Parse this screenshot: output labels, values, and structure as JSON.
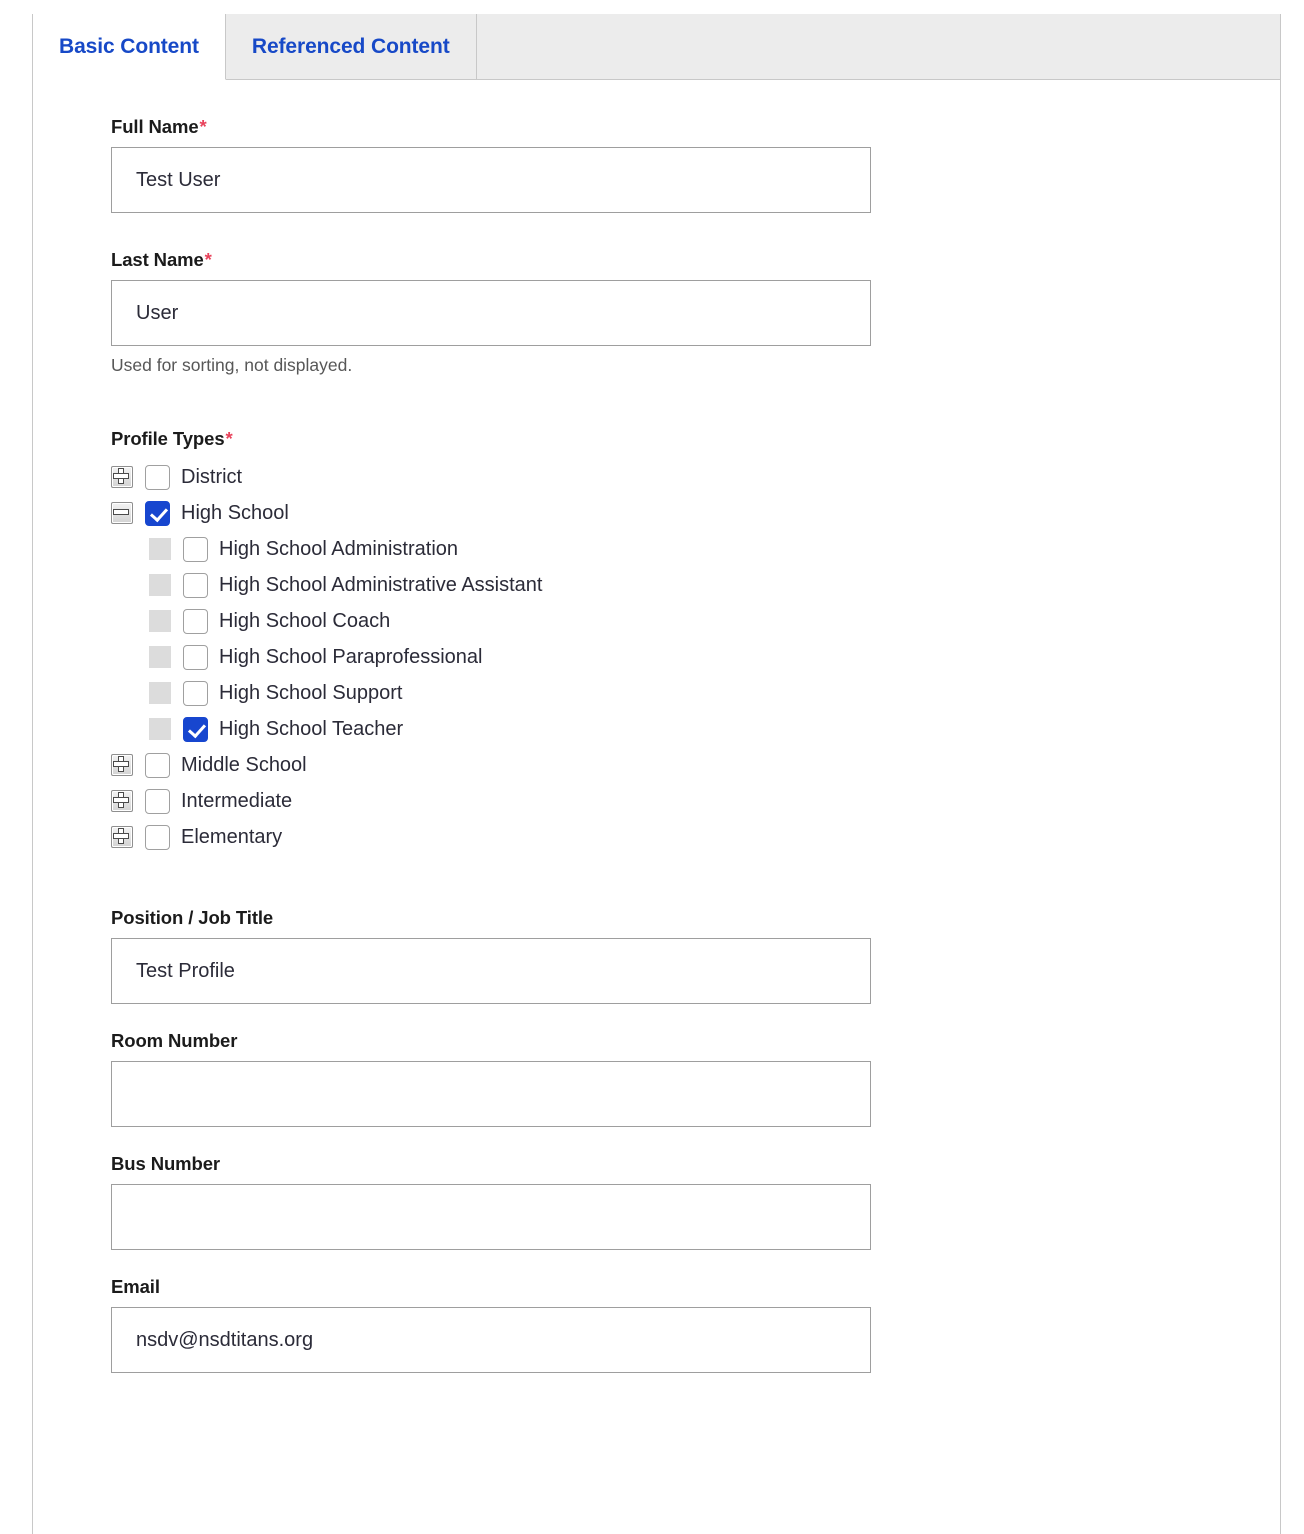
{
  "tabs": [
    {
      "label": "Basic Content",
      "active": true
    },
    {
      "label": "Referenced Content",
      "active": false
    }
  ],
  "fields": {
    "full_name": {
      "label": "Full Name",
      "required": true,
      "value": "Test User",
      "placeholder": ""
    },
    "last_name": {
      "label": "Last Name",
      "required": true,
      "value": "User",
      "placeholder": "",
      "helper": "Used for sorting, not displayed."
    },
    "profile_types": {
      "label": "Profile Types",
      "required": true
    },
    "position": {
      "label": "Position / Job Title",
      "required": false,
      "value": "Test Profile",
      "placeholder": ""
    },
    "room_number": {
      "label": "Room Number",
      "required": false,
      "value": "",
      "placeholder": ""
    },
    "bus_number": {
      "label": "Bus Number",
      "required": false,
      "value": "",
      "placeholder": ""
    },
    "email": {
      "label": "Email",
      "required": false,
      "value": "nsdv@nsdtitans.org",
      "placeholder": ""
    }
  },
  "tree": [
    {
      "label": "District",
      "level": 0,
      "expander": "plus",
      "checked": false
    },
    {
      "label": "High School",
      "level": 0,
      "expander": "minus",
      "checked": true
    },
    {
      "label": "High School Administration",
      "level": 1,
      "expander": "blank",
      "checked": false
    },
    {
      "label": "High School Administrative Assistant",
      "level": 1,
      "expander": "blank",
      "checked": false
    },
    {
      "label": "High School Coach",
      "level": 1,
      "expander": "blank",
      "checked": false
    },
    {
      "label": "High School Paraprofessional",
      "level": 1,
      "expander": "blank",
      "checked": false
    },
    {
      "label": "High School Support",
      "level": 1,
      "expander": "blank",
      "checked": false
    },
    {
      "label": "High School Teacher",
      "level": 1,
      "expander": "blank",
      "checked": true
    },
    {
      "label": "Middle School",
      "level": 0,
      "expander": "plus",
      "checked": false
    },
    {
      "label": "Intermediate",
      "level": 0,
      "expander": "plus",
      "checked": false
    },
    {
      "label": "Elementary",
      "level": 0,
      "expander": "plus",
      "checked": false
    }
  ],
  "colors": {
    "tab_link": "#1749c7",
    "required_asterisk": "#e8415a",
    "checkbox_checked": "#1746cf",
    "tabstrip_bg": "#ececec",
    "border": "#c8c8c8",
    "input_border": "#9e9e9e",
    "helper_text": "#575757"
  }
}
